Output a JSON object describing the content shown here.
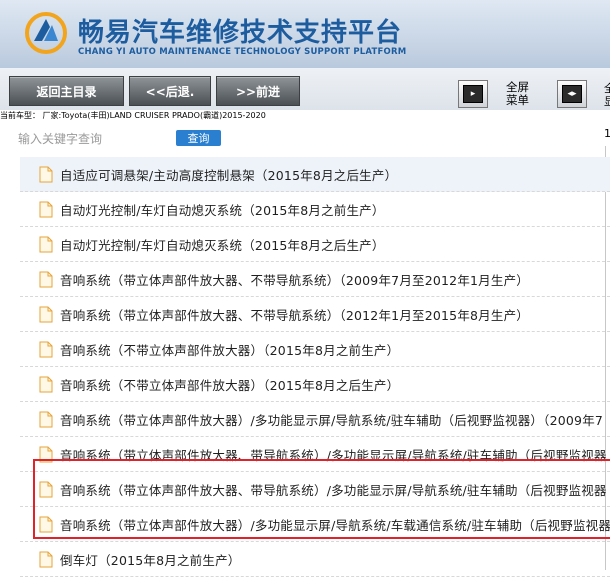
{
  "header": {
    "title": "畅易汽车维修技术支持平台",
    "subtitle": "CHANG YI AUTO MAINTENANCE TECHNOLOGY SUPPORT PLATFORM"
  },
  "toolbar": {
    "main_menu_label": "返回主目录",
    "back_label": "<<后退.",
    "forward_label": ">>前进",
    "fullscreen_label_line1": "全屏",
    "fullscreen_label_line2": "菜单",
    "cut_label_1": "全",
    "cut_label_2": "显"
  },
  "breadcrumb": "当前车型：  厂家:Toyota(丰田)LAND CRUISER PRADO(霸道)2015-2020",
  "search": {
    "placeholder": "输入关键字查询",
    "button_label": "查询",
    "right_mark": "1"
  },
  "items": [
    "自适应可调悬架/主动高度控制悬架（2015年8月之后生产）",
    "自动灯光控制/车灯自动熄灭系统（2015年8月之前生产）",
    "自动灯光控制/车灯自动熄灭系统（2015年8月之后生产）",
    "音响系统（带立体声部件放大器、不带导航系统）（2009年7月至2012年1月生产）",
    "音响系统（带立体声部件放大器、不带导航系统）（2012年1月至2015年8月生产）",
    "音响系统（不带立体声部件放大器）（2015年8月之前生产）",
    "音响系统（不带立体声部件放大器）（2015年8月之后生产）",
    "音响系统（带立体声部件放大器）/多功能显示屏/导航系统/驻车辅助（后视野监视器）（2009年7",
    "音响系统（带立体声部件放大器、带导航系统）/多功能显示屏/导航系统/驻车辅助（后视野监视器",
    "音响系统（带立体声部件放大器、带导航系统）/多功能显示屏/导航系统/驻车辅助（后视野监视器",
    "音响系统（带立体声部件放大器）/多功能显示屏/导航系统/车载通信系统/驻车辅助（后视野监视器",
    "倒车灯（2015年8月之前生产）"
  ],
  "colors": {
    "brand": "#1d5d9f",
    "search_button": "#2a7fd0",
    "highlight_border": "#e0222a"
  }
}
